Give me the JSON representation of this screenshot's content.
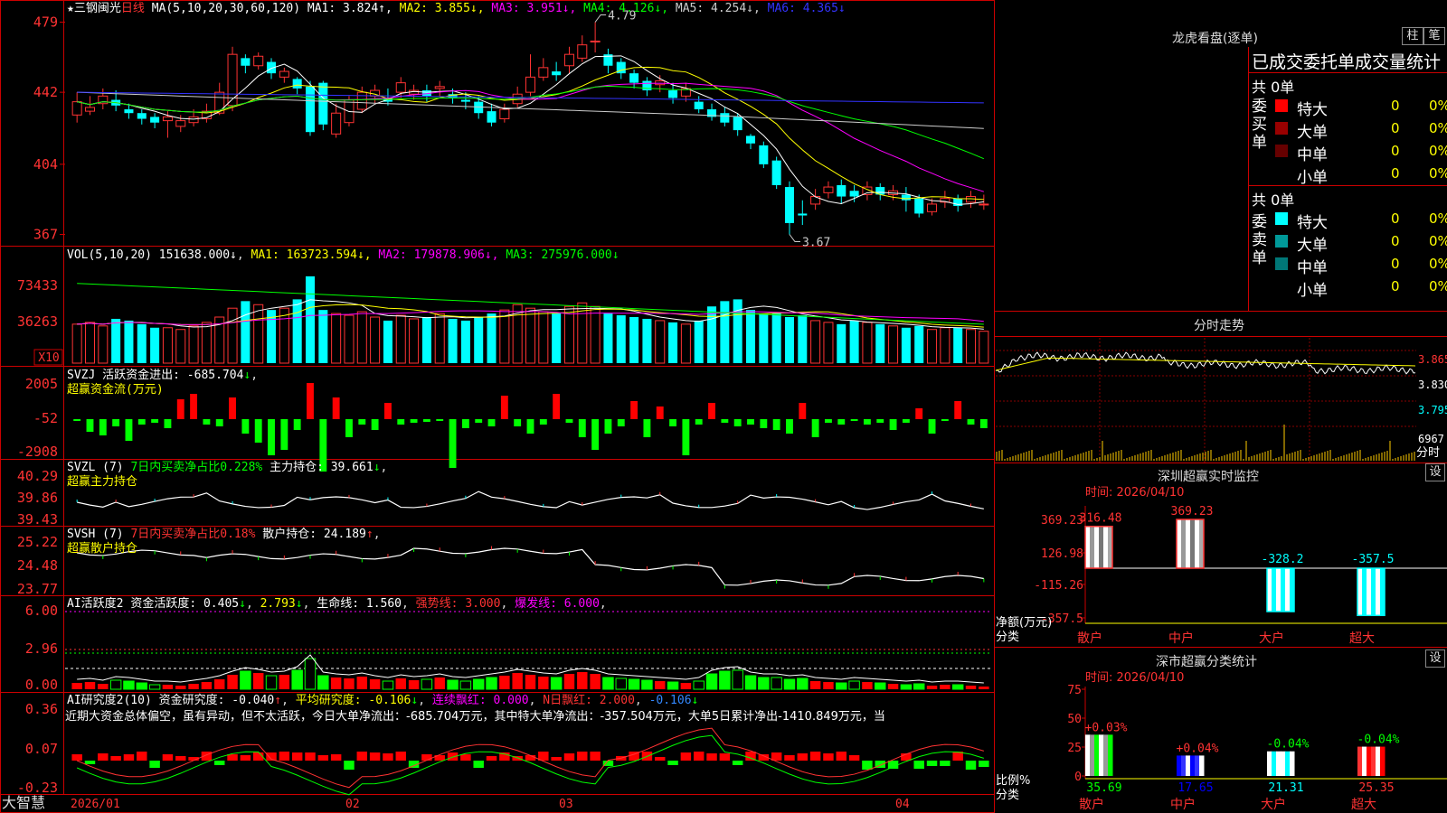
{
  "stock": {
    "name": "三钢闽光",
    "period": "日线",
    "star": "★"
  },
  "main": {
    "ma_label": "MA(5,10,20,30,60,120)",
    "ma_values": [
      {
        "name": "MA1",
        "value": "3.824",
        "arrow": "↑",
        "color": "#ffffff"
      },
      {
        "name": "MA2",
        "value": "3.855",
        "arrow": "↓",
        "color": "#ffff00"
      },
      {
        "name": "MA3",
        "value": "3.951",
        "arrow": "↓",
        "color": "#ff00ff"
      },
      {
        "name": "MA4",
        "value": "4.126",
        "arrow": "↓",
        "color": "#00ff00"
      },
      {
        "name": "MA5",
        "value": "4.254",
        "arrow": "↓",
        "color": "#cccccc"
      },
      {
        "name": "MA6",
        "value": "4.365",
        "arrow": "↓",
        "color": "#3333ff"
      }
    ],
    "y_ticks": [
      "479",
      "442",
      "404",
      "367"
    ],
    "y_vals": [
      4.79,
      4.42,
      4.04,
      3.67
    ],
    "high_label": "4.79",
    "low_label": "3.67"
  },
  "vol": {
    "label": "VOL(5,10,20)",
    "value": "151638.000",
    "arrow": "↓",
    "ma1": "163723.594",
    "ma2": "179878.906",
    "ma3": "275976.000",
    "y_ticks": [
      "73433",
      "36263"
    ],
    "x10": "X10"
  },
  "svzj": {
    "label": "SVZJ",
    "desc": "活跃资金进出:",
    "value": "-685.704",
    "arrow": "↓",
    "sub": "超赢资金流(万元)",
    "y_ticks": [
      "2005",
      "-52",
      "-2908"
    ]
  },
  "svzl": {
    "label": "SVZL (7)",
    "desc": "7日内买卖净占比0.228%",
    "desc2": "主力持仓:",
    "value": "39.661",
    "arrow": "↓",
    "sub": "超赢主力持仓",
    "y_ticks": [
      "40.29",
      "39.86",
      "39.43"
    ]
  },
  "svsh": {
    "label": "SVSH (7)",
    "desc": "7日内买卖净占比0.18%",
    "desc2": "散户持仓:",
    "value": "24.189",
    "arrow": "↑",
    "sub": "超赢散户持仓",
    "y_ticks": [
      "25.22",
      "24.48",
      "23.77"
    ]
  },
  "ai1": {
    "label": "AI活跃度2",
    "desc": "资金活跃度:",
    "value": "0.405",
    "v2": "2.793",
    "life_label": "生命线:",
    "life": "1.560",
    "strong": "强势线: 3.000",
    "burst": "爆发线: 6.000",
    "y_ticks": [
      "6.00",
      "2.96",
      "0.00"
    ]
  },
  "ai2": {
    "label": "AI研究度2(10)",
    "desc": "资金研究度:",
    "value": "-0.040",
    "avg_label": "平均研究度:",
    "avg": "-0.106",
    "cont_label": "连续飘红:",
    "cont": "0.000",
    "n_label": "N日飘红:",
    "n": "2.000",
    "tail": "-0.106",
    "y_ticks": [
      "0.36",
      "0.07",
      "-0.23"
    ],
    "comment": "近期大资金总体偏空，虽有异动，但不太活跃，今日大单净流出：-685.704万元，其中特大单净流出：-357.504万元，大单5日累计净出-1410.849万元，当"
  },
  "xaxis": {
    "labels": [
      "2026/01",
      "02",
      "03",
      "04"
    ],
    "brand": "大智慧"
  },
  "lhb": {
    "title": "龙虎看盘(逐单)",
    "btn1": "柱",
    "btn2": "笔",
    "subtitle": "已成交委托单成交量统计",
    "buy_label": "委买单",
    "sell_label": "委卖单",
    "buy_total": "共 0单",
    "sell_total": "共 0单",
    "buy_rows": [
      {
        "name": "特大",
        "count": "0",
        "pct": "0%",
        "color": "#ff0000"
      },
      {
        "name": "大单",
        "count": "0",
        "pct": "0%",
        "color": "#990000"
      },
      {
        "name": "中单",
        "count": "0",
        "pct": "0%",
        "color": "#660000"
      },
      {
        "name": "小单",
        "count": "0",
        "pct": "0%",
        "color": "#000000"
      }
    ],
    "sell_rows": [
      {
        "name": "特大",
        "count": "0",
        "pct": "0%",
        "color": "#00ffff"
      },
      {
        "name": "大单",
        "count": "0",
        "pct": "0%",
        "color": "#009999"
      },
      {
        "name": "中单",
        "count": "0",
        "pct": "0%",
        "color": "#007777"
      },
      {
        "name": "小单",
        "count": "0",
        "pct": "0%",
        "color": "#000000"
      }
    ]
  },
  "intraday": {
    "title": "分时走势",
    "y_ticks": [
      "3.865",
      "3.830",
      "3.795"
    ],
    "vol_top": "6967",
    "vol_unit": "分时"
  },
  "sz_monitor": {
    "title": "深圳超赢实时监控",
    "btn": "设",
    "time": "时间: 2026/04/10",
    "y_ticks": [
      "369.23",
      "126.98",
      "-115.26",
      "-357.5"
    ],
    "ylabel1": "净额(万元)",
    "ylabel2": "分类",
    "cats": [
      "散户",
      "中户",
      "大户",
      "超大"
    ],
    "values": [
      316.48,
      369.23,
      -328.2,
      -357.5
    ],
    "value_labels": [
      "316.48",
      "369.23",
      "-328.2",
      "-357.5"
    ]
  },
  "sz_stats": {
    "title": "深市超赢分类统计",
    "btn": "设",
    "time": "时间: 2026/04/10",
    "y_ticks": [
      "75",
      "50",
      "25",
      "0"
    ],
    "ylabel1": "比例%",
    "ylabel2": "分类",
    "cats": [
      "散户",
      "中户",
      "大户",
      "超大"
    ],
    "values": [
      35.69,
      17.65,
      21.31,
      25.35
    ],
    "changes": [
      "+0.03%",
      "+0.04%",
      "-0.04%",
      "-0.04%"
    ],
    "value_labels": [
      "35.69",
      "17.65",
      "21.31",
      "25.35"
    ]
  },
  "chart_data": {
    "type": "candlestick",
    "candles_open": [
      4.3,
      4.32,
      4.36,
      4.38,
      4.33,
      4.31,
      4.29,
      4.27,
      4.24,
      4.26,
      4.28,
      4.31,
      4.35,
      4.6,
      4.56,
      4.58,
      4.5,
      4.49,
      4.45,
      4.47,
      4.2,
      4.26,
      4.33,
      4.4,
      4.39,
      4.42,
      4.41,
      4.43,
      4.44,
      4.41,
      4.38,
      4.37,
      4.32,
      4.28,
      4.36,
      4.42,
      4.5,
      4.53,
      4.56,
      4.6,
      4.69,
      4.62,
      4.58,
      4.52,
      4.48,
      4.46,
      4.43,
      4.4,
      4.37,
      4.33,
      4.31,
      4.29,
      4.19,
      4.14,
      4.06,
      3.92,
      3.78,
      3.83,
      3.89,
      3.93,
      3.9,
      3.88,
      3.92,
      3.88,
      3.88,
      3.86,
      3.79,
      3.84,
      3.86,
      3.84,
      3.83
    ],
    "candles_close": [
      4.37,
      4.34,
      4.4,
      4.35,
      4.31,
      4.28,
      4.26,
      4.29,
      4.27,
      4.29,
      4.32,
      4.42,
      4.62,
      4.56,
      4.61,
      4.52,
      4.53,
      4.44,
      4.21,
      4.25,
      4.31,
      4.38,
      4.42,
      4.43,
      4.37,
      4.47,
      4.43,
      4.4,
      4.45,
      4.39,
      4.37,
      4.31,
      4.26,
      4.33,
      4.41,
      4.5,
      4.55,
      4.51,
      4.62,
      4.67,
      4.69,
      4.56,
      4.52,
      4.47,
      4.43,
      4.48,
      4.39,
      4.44,
      4.33,
      4.29,
      4.26,
      4.22,
      4.15,
      4.04,
      3.93,
      3.73,
      3.77,
      3.87,
      3.92,
      3.87,
      3.87,
      3.92,
      3.88,
      3.9,
      3.85,
      3.78,
      3.83,
      3.86,
      3.82,
      3.87,
      3.83
    ],
    "candles_high": [
      4.42,
      4.4,
      4.44,
      4.43,
      4.36,
      4.33,
      4.31,
      4.32,
      4.3,
      4.33,
      4.36,
      4.47,
      4.66,
      4.62,
      4.63,
      4.6,
      4.55,
      4.5,
      4.48,
      4.48,
      4.36,
      4.4,
      4.45,
      4.46,
      4.44,
      4.5,
      4.46,
      4.46,
      4.48,
      4.44,
      4.42,
      4.4,
      4.36,
      4.36,
      4.45,
      4.62,
      4.6,
      4.58,
      4.66,
      4.72,
      4.79,
      4.65,
      4.6,
      4.54,
      4.5,
      4.51,
      4.47,
      4.47,
      4.4,
      4.36,
      4.34,
      4.31,
      4.2,
      4.16,
      4.08,
      3.95,
      3.85,
      3.91,
      3.95,
      3.96,
      3.93,
      3.95,
      3.94,
      3.93,
      3.92,
      3.88,
      3.86,
      3.9,
      3.88,
      3.9,
      3.88
    ],
    "candles_low": [
      4.26,
      4.3,
      4.33,
      4.32,
      4.28,
      4.25,
      4.23,
      4.18,
      4.21,
      4.24,
      4.26,
      4.3,
      4.32,
      4.52,
      4.54,
      4.49,
      4.47,
      4.41,
      4.19,
      4.22,
      4.18,
      4.24,
      4.31,
      4.36,
      4.35,
      4.39,
      4.38,
      4.37,
      4.4,
      4.36,
      4.33,
      4.28,
      4.24,
      4.26,
      4.34,
      4.4,
      4.48,
      4.48,
      4.52,
      4.58,
      4.63,
      4.52,
      4.49,
      4.44,
      4.4,
      4.42,
      4.36,
      4.37,
      4.31,
      4.27,
      4.24,
      4.19,
      4.12,
      4.02,
      3.91,
      3.67,
      3.72,
      3.8,
      3.86,
      3.83,
      3.84,
      3.85,
      3.85,
      3.85,
      3.79,
      3.76,
      3.77,
      3.81,
      3.79,
      3.81,
      3.8
    ],
    "volume": [
      22,
      23,
      21,
      25,
      24,
      22,
      20,
      20,
      19,
      21,
      23,
      26,
      31,
      35,
      33,
      30,
      31,
      36,
      49,
      30,
      28,
      27,
      29,
      26,
      24,
      27,
      25,
      26,
      28,
      25,
      24,
      26,
      28,
      30,
      33,
      31,
      29,
      28,
      32,
      34,
      32,
      28,
      27,
      26,
      25,
      24,
      23,
      22,
      24,
      32,
      35,
      36,
      30,
      28,
      28,
      26,
      27,
      24,
      23,
      22,
      24,
      23,
      22,
      21,
      20,
      21,
      19,
      20,
      20,
      19,
      18
    ],
    "flow": [
      -52,
      -700,
      -900,
      -400,
      -1200,
      -300,
      -200,
      -500,
      1100,
      1400,
      -300,
      -400,
      1200,
      -800,
      -1300,
      -2000,
      -1700,
      -600,
      2000,
      -2900,
      1200,
      -1000,
      -300,
      -600,
      900,
      -300,
      -200,
      -150,
      -100,
      -2700,
      -500,
      -200,
      -400,
      1300,
      -400,
      -800,
      -300,
      1400,
      -200,
      -1000,
      -1700,
      -800,
      -400,
      1000,
      -1000,
      700,
      -400,
      -2000,
      -300,
      900,
      -200,
      -400,
      -300,
      -500,
      -600,
      -800,
      900,
      -1000,
      -200,
      -300,
      -100,
      -300,
      -200,
      -600,
      -200,
      600,
      -800,
      -100,
      1000,
      -300,
      -500
    ]
  }
}
